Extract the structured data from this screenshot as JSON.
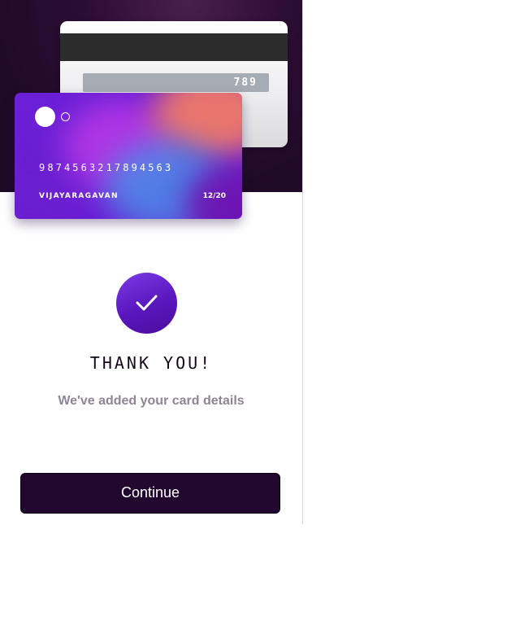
{
  "card_back": {
    "cvv": "789"
  },
  "card_front": {
    "number": "9874563217894563",
    "holder": "VIJAYARAGAVAN",
    "expiry": "12/20"
  },
  "confirmation": {
    "icon": "check-icon",
    "title": "THANK YOU!",
    "message": "We've added your card details"
  },
  "actions": {
    "continue_label": "Continue"
  },
  "colors": {
    "hero_background": "#1f0a28",
    "accent_purple": "#5a16bd",
    "button_background": "#22082e",
    "subtitle_text": "#8e8595"
  }
}
